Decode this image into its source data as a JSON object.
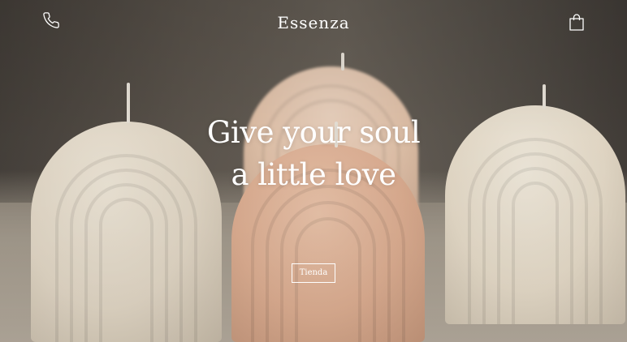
{
  "header": {
    "logo": "Essenza",
    "phone_icon": "phone-icon",
    "cart_icon": "shopping-bag-icon"
  },
  "hero": {
    "headline_line1": "Give your soul",
    "headline_line2": "a little love",
    "cta_label": "Tienda",
    "image": "arch-candles-photo"
  },
  "colors": {
    "text": "#ffffff",
    "candle_pink": "#e2b295",
    "candle_cream": "#ebe0cd"
  }
}
